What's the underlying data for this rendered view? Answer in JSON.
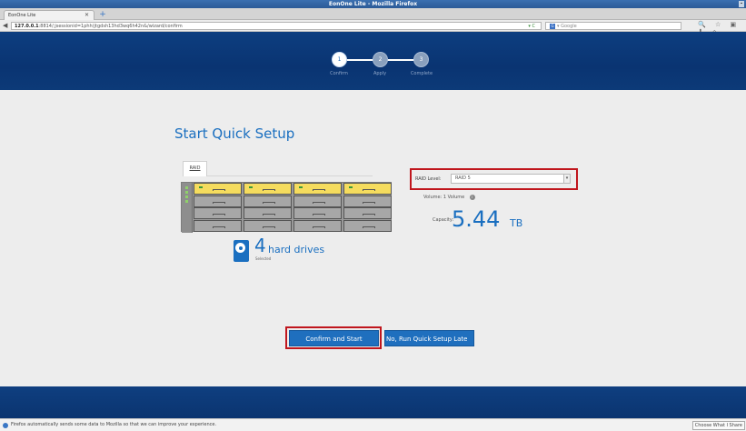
{
  "window": {
    "title": "EonOne Lite - Mozilla Firefox",
    "close_glyph": "–"
  },
  "browser": {
    "tab_label": "EonOne Lite",
    "tab_close": "✕",
    "new_tab": "+",
    "back": "◀",
    "url_host": "127.0.0.1",
    "url_rest": ":8814/;jsessionid=1phh(jtgdsh13hd3wq6h42n&/wizard/confirm",
    "url_icons": "▾ C",
    "search_engine_icon": "G",
    "search_placeholder": "▾ Google",
    "toolbar_icons": "🔍 ☆ ▣ ⬇ ⌂",
    "status_message": "Firefox automatically sends some data to Mozilla so that we can improve your experience.",
    "status_button": "Choose What I Share"
  },
  "wizard": {
    "steps": [
      {
        "number": "1",
        "label": "Confirm",
        "state": "active"
      },
      {
        "number": "2",
        "label": "Apply",
        "state": "inactive"
      },
      {
        "number": "3",
        "label": "Complete",
        "state": "inactive"
      }
    ]
  },
  "main": {
    "title": "Start Quick Setup",
    "raid_tab": "RAID",
    "drives": {
      "count": "4",
      "label": "hard drives",
      "sublabel": "Selected",
      "bays_total": 16,
      "bays_selected": 4
    },
    "raid_level": {
      "label": "RAID Level:",
      "value": "RAID 5",
      "arrow": "▾"
    },
    "volume": {
      "label": "Volume:",
      "value": "1 Volume",
      "info": "i"
    },
    "capacity": {
      "label": "Capacity:",
      "value": "5.44",
      "unit": "TB"
    },
    "buttons": {
      "confirm": "Confirm and Start",
      "later": "No, Run Quick Setup Late"
    }
  },
  "colors": {
    "accent": "#1a6fc0",
    "highlight": "#c0161d",
    "selected_bay": "#f5dc5e",
    "header": "#0a3472"
  }
}
